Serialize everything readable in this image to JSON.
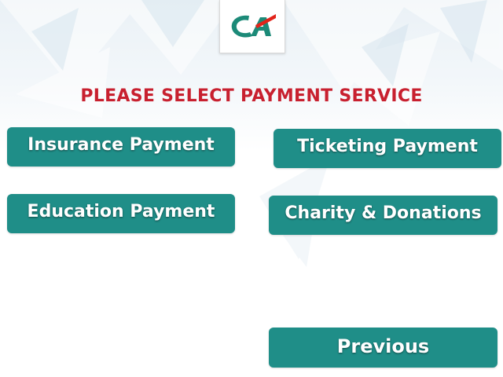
{
  "brand": {
    "logo": "credit-agricole-logo"
  },
  "heading": "PLEASE SELECT PAYMENT SERVICE",
  "buttons": {
    "insurance": "Insurance Payment",
    "ticketing": "Ticketing Payment",
    "education": "Education Payment",
    "charity": "Charity & Donations",
    "previous": "Previous"
  },
  "colors": {
    "button": "#1f8e88",
    "heading": "#c8202f",
    "logo_green": "#1c8a78",
    "logo_red": "#e2231a"
  }
}
